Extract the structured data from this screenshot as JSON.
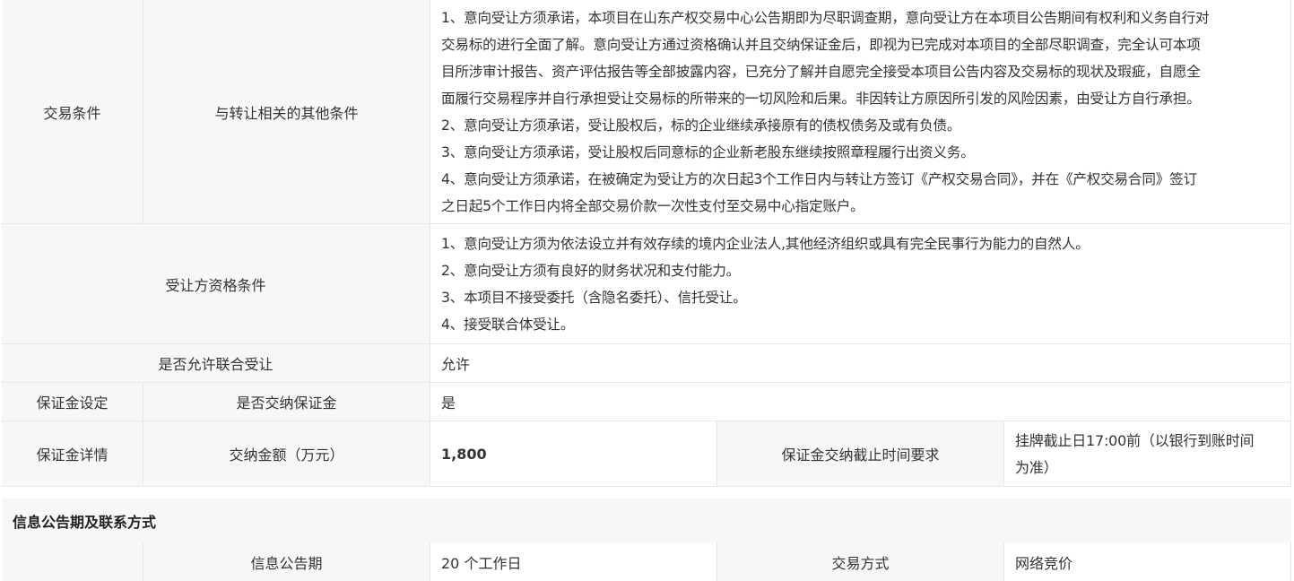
{
  "trade_conditions": {
    "label": "交易条件",
    "other_conditions": {
      "label": "与转让相关的其他条件",
      "lines": [
        "1、意向受让方须承诺，本项目在山东产权交易中心公告期即为尽职调查期，意向受让方在本项目公告期间有权利和义务自行对",
        "交易标的进行全面了解。意向受让方通过资格确认并且交纳保证金后，即视为已完成对本项目的全部尽职调查，完全认可本项",
        "目所涉审计报告、资产评估报告等全部披露内容，已充分了解并自愿完全接受本项目公告内容及交易标的现状及瑕疵，自愿全",
        "面履行交易程序并自行承担受让交易标的所带来的一切风险和后果。非因转让方原因所引发的风险因素，由受让方自行承担。",
        "2、意向受让方须承诺，受让股权后，标的企业继续承接原有的债权债务及或有负债。",
        "3、意向受让方须承诺，受让股权后同意标的企业新老股东继续按照章程履行出资义务。",
        "4、意向受让方须承诺，在被确定为受让方的次日起3个工作日内与转让方签订《产权交易合同》，并在《产权交易合同》签订",
        "之日起5个工作日内将全部交易价款一次性支付至交易中心指定账户。"
      ]
    },
    "qualification": {
      "label": "受让方资格条件",
      "lines": [
        "1、意向受让方须为依法设立并有效存续的境内企业法人,其他经济组织或具有完全民事行为能力的自然人。",
        "2、意向受让方须有良好的财务状况和支付能力。",
        "3、本项目不接受委托（含隐名委托）、信托受让。",
        "4、接受联合体受让。"
      ]
    },
    "joint_transfer": {
      "label": "是否允许联合受让",
      "value": "允许"
    }
  },
  "deposit": {
    "setting_label": "保证金设定",
    "required_label": "是否交纳保证金",
    "required_value": "是",
    "details_label": "保证金详情",
    "amount_label": "交纳金额（万元）",
    "amount_value": "1,800",
    "deadline_label": "保证金交纳截止时间要求",
    "deadline_line1": "挂牌截止日17:00前（以银行到账时间",
    "deadline_line2": "为准）"
  },
  "info_section": {
    "title": "信息公告期及联系方式",
    "period_label": "信息公告期",
    "period_value": "20 个工作日",
    "method_label": "交易方式",
    "method_value": "网络竞价"
  }
}
